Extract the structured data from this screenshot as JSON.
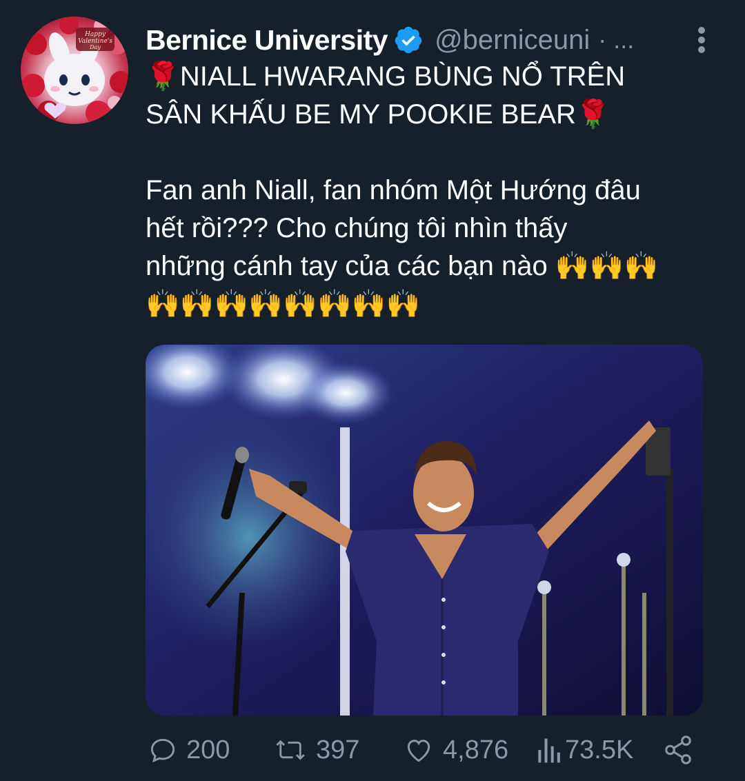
{
  "tweet": {
    "author": {
      "display_name": "Bernice University",
      "handle": "@berniceuni",
      "separator": "· ...",
      "verified": true,
      "avatar_caption": "Happy Valentine's Day"
    },
    "text": {
      "line1": "NIALL HWARANG BÙNG NỔ TRÊN",
      "line2": "SÂN KHẤU BE MY POOKIE BEAR",
      "line3": "Fan anh Niall, fan nhóm Một Hướng đâu",
      "line4": "hết rồi??? Cho chúng tôi nhìn thấy",
      "line5": "những cánh tay của các bạn nào 🙌🙌🙌",
      "line6": "🙌🙌🙌🙌🙌🙌🙌🙌",
      "rose_emoji": "🌹"
    },
    "stats": {
      "replies": "200",
      "retweets": "397",
      "likes": "4,876",
      "views": "73.5K"
    }
  },
  "icons": {
    "more": "more-vertical-icon",
    "reply": "reply-icon",
    "retweet": "retweet-icon",
    "like": "heart-icon",
    "views": "views-icon",
    "share": "share-icon"
  },
  "colors": {
    "background": "#15202b",
    "secondary_text": "#8b98a5",
    "verified_blue": "#1d9bf0"
  }
}
